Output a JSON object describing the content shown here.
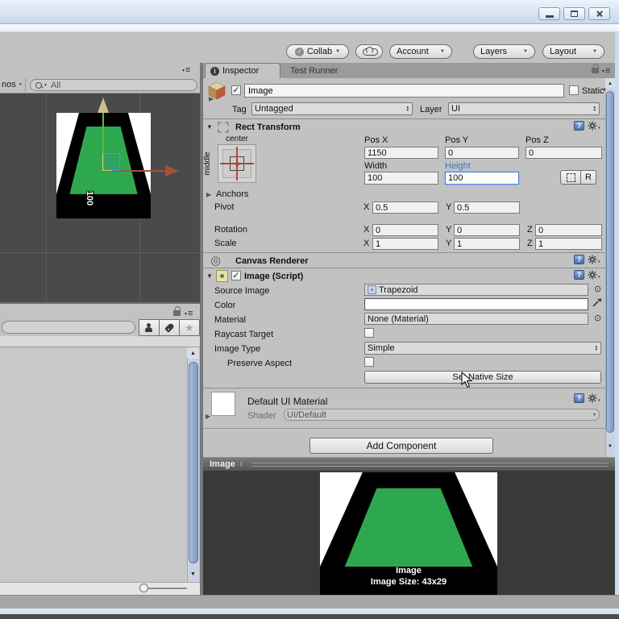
{
  "window": {
    "controls": [
      "minimize",
      "restore",
      "close"
    ]
  },
  "toolbar": {
    "collab_label": "Collab",
    "account_label": "Account",
    "layers_label": "Layers",
    "layout_label": "Layout"
  },
  "scene_panel": {
    "gizmos_fragment": "nos",
    "search_text": "All",
    "size_label": "100"
  },
  "project_panel": {
    "search_text": ""
  },
  "tabs": {
    "inspector": "Inspector",
    "test_runner": "Test Runner"
  },
  "game_object": {
    "name": "Image",
    "static_label": "Static",
    "tag_label": "Tag",
    "tag_value": "Untagged",
    "layer_label": "Layer",
    "layer_value": "UI"
  },
  "rect_transform": {
    "title": "Rect Transform",
    "anchor_h": "center",
    "anchor_v": "middle",
    "pos_x_label": "Pos X",
    "pos_y_label": "Pos Y",
    "pos_z_label": "Pos Z",
    "pos_x": "1150",
    "pos_y": "0",
    "pos_z": "0",
    "width_label": "Width",
    "height_label": "Height",
    "width": "100",
    "height": "100",
    "r_button": "R",
    "anchors_label": "Anchors",
    "pivot_label": "Pivot",
    "pivot_x": "0.5",
    "pivot_y": "0.5",
    "rotation_label": "Rotation",
    "rotation_x": "0",
    "rotation_y": "0",
    "rotation_z": "0",
    "scale_label": "Scale",
    "scale_x": "1",
    "scale_y": "1",
    "scale_z": "1",
    "x": "X",
    "y": "Y",
    "z": "Z"
  },
  "canvas_renderer": {
    "title": "Canvas Renderer"
  },
  "image_component": {
    "title": "Image (Script)",
    "source_image_label": "Source Image",
    "source_image": "Trapezoid",
    "color_label": "Color",
    "material_label": "Material",
    "material_value": "None (Material)",
    "raycast_label": "Raycast Target",
    "image_type_label": "Image Type",
    "image_type": "Simple",
    "preserve_label": "Preserve Aspect",
    "set_native_size": "Set Native Size"
  },
  "material_section": {
    "title": "Default UI Material",
    "shader_label": "Shader",
    "shader_value": "UI/Default"
  },
  "add_component_label": "Add Component",
  "preview": {
    "tab_label": "Image",
    "caption_title": "Image",
    "caption_size": "Image Size: 43x29"
  },
  "icons": {
    "object_picker": "⊙",
    "canvas_renderer": "◎",
    "star": "★",
    "check": "✓",
    "menu": "≡",
    "dropdown": "▾"
  },
  "colors": {
    "accent_blue": "#3E6FD0",
    "sprite_green": "#2EA84F",
    "axis_green": "#63B53C",
    "axis_red": "#A85038",
    "scene_bg": "#4A4A4A",
    "preview_bg": "#393939",
    "panel_bg": "#C2C2C2"
  }
}
